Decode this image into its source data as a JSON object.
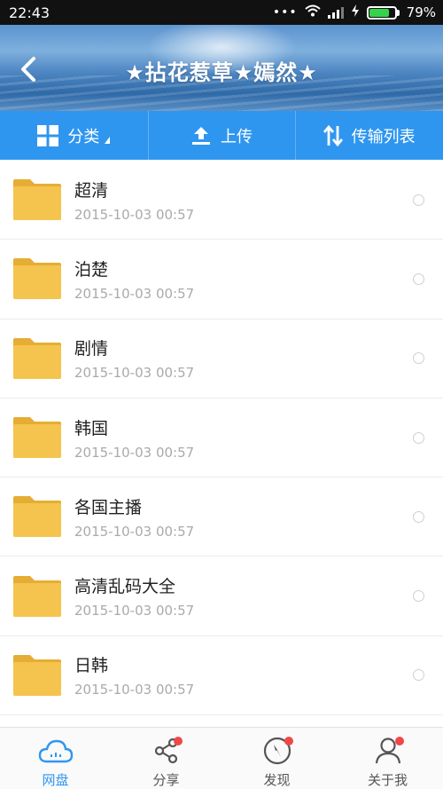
{
  "status_bar": {
    "time": "22:43",
    "battery_percent_label": "79%",
    "battery_level": 0.79,
    "icons": [
      "dots-icon",
      "wifi-icon",
      "signal-icon",
      "charging-icon",
      "battery-icon"
    ]
  },
  "header": {
    "title": "★拈花惹草★嫣然★",
    "back_icon": "back-chevron-icon"
  },
  "toolbar": {
    "category_label": "分类",
    "upload_label": "上传",
    "transfer_label": "传输列表"
  },
  "files": [
    {
      "name": "超清",
      "date": "2015-10-03  00:57"
    },
    {
      "name": "泊楚",
      "date": "2015-10-03  00:57"
    },
    {
      "name": "剧情",
      "date": "2015-10-03  00:57"
    },
    {
      "name": "韩国",
      "date": "2015-10-03  00:57"
    },
    {
      "name": "各国主播",
      "date": "2015-10-03  00:57"
    },
    {
      "name": "高清乱码大全",
      "date": "2015-10-03  00:57"
    },
    {
      "name": "日韩",
      "date": "2015-10-03  00:57"
    }
  ],
  "bottom_nav": [
    {
      "label": "网盘",
      "icon": "cloud-icon",
      "active": true,
      "badge": false
    },
    {
      "label": "分享",
      "icon": "share-icon",
      "active": false,
      "badge": true
    },
    {
      "label": "发现",
      "icon": "compass-icon",
      "active": false,
      "badge": true
    },
    {
      "label": "关于我",
      "icon": "user-icon",
      "active": false,
      "badge": true
    }
  ],
  "colors": {
    "accent": "#2f96f0",
    "folder": "#f5c44e",
    "badge": "#f04848"
  }
}
